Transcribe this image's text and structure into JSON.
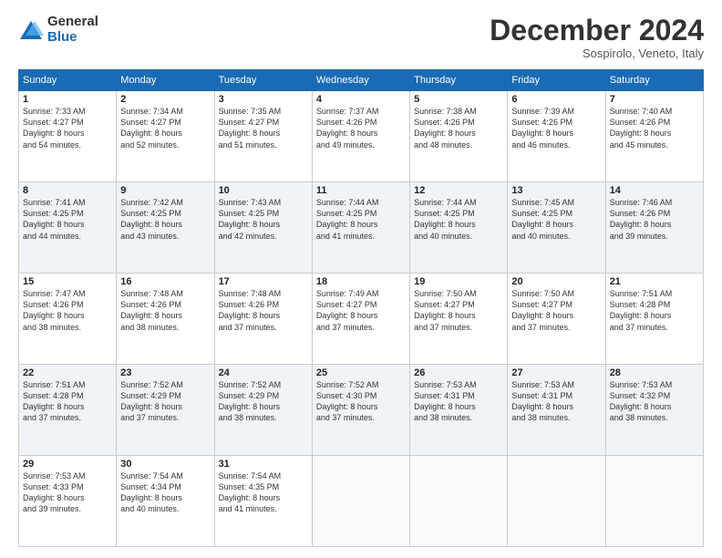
{
  "logo": {
    "general": "General",
    "blue": "Blue"
  },
  "title": "December 2024",
  "location": "Sospirolo, Veneto, Italy",
  "headers": [
    "Sunday",
    "Monday",
    "Tuesday",
    "Wednesday",
    "Thursday",
    "Friday",
    "Saturday"
  ],
  "weeks": [
    [
      {
        "day": "1",
        "info": "Sunrise: 7:33 AM\nSunset: 4:27 PM\nDaylight: 8 hours\nand 54 minutes."
      },
      {
        "day": "2",
        "info": "Sunrise: 7:34 AM\nSunset: 4:27 PM\nDaylight: 8 hours\nand 52 minutes."
      },
      {
        "day": "3",
        "info": "Sunrise: 7:35 AM\nSunset: 4:27 PM\nDaylight: 8 hours\nand 51 minutes."
      },
      {
        "day": "4",
        "info": "Sunrise: 7:37 AM\nSunset: 4:26 PM\nDaylight: 8 hours\nand 49 minutes."
      },
      {
        "day": "5",
        "info": "Sunrise: 7:38 AM\nSunset: 4:26 PM\nDaylight: 8 hours\nand 48 minutes."
      },
      {
        "day": "6",
        "info": "Sunrise: 7:39 AM\nSunset: 4:26 PM\nDaylight: 8 hours\nand 46 minutes."
      },
      {
        "day": "7",
        "info": "Sunrise: 7:40 AM\nSunset: 4:26 PM\nDaylight: 8 hours\nand 45 minutes."
      }
    ],
    [
      {
        "day": "8",
        "info": "Sunrise: 7:41 AM\nSunset: 4:25 PM\nDaylight: 8 hours\nand 44 minutes."
      },
      {
        "day": "9",
        "info": "Sunrise: 7:42 AM\nSunset: 4:25 PM\nDaylight: 8 hours\nand 43 minutes."
      },
      {
        "day": "10",
        "info": "Sunrise: 7:43 AM\nSunset: 4:25 PM\nDaylight: 8 hours\nand 42 minutes."
      },
      {
        "day": "11",
        "info": "Sunrise: 7:44 AM\nSunset: 4:25 PM\nDaylight: 8 hours\nand 41 minutes."
      },
      {
        "day": "12",
        "info": "Sunrise: 7:44 AM\nSunset: 4:25 PM\nDaylight: 8 hours\nand 40 minutes."
      },
      {
        "day": "13",
        "info": "Sunrise: 7:45 AM\nSunset: 4:25 PM\nDaylight: 8 hours\nand 40 minutes."
      },
      {
        "day": "14",
        "info": "Sunrise: 7:46 AM\nSunset: 4:26 PM\nDaylight: 8 hours\nand 39 minutes."
      }
    ],
    [
      {
        "day": "15",
        "info": "Sunrise: 7:47 AM\nSunset: 4:26 PM\nDaylight: 8 hours\nand 38 minutes."
      },
      {
        "day": "16",
        "info": "Sunrise: 7:48 AM\nSunset: 4:26 PM\nDaylight: 8 hours\nand 38 minutes."
      },
      {
        "day": "17",
        "info": "Sunrise: 7:48 AM\nSunset: 4:26 PM\nDaylight: 8 hours\nand 37 minutes."
      },
      {
        "day": "18",
        "info": "Sunrise: 7:49 AM\nSunset: 4:27 PM\nDaylight: 8 hours\nand 37 minutes."
      },
      {
        "day": "19",
        "info": "Sunrise: 7:50 AM\nSunset: 4:27 PM\nDaylight: 8 hours\nand 37 minutes."
      },
      {
        "day": "20",
        "info": "Sunrise: 7:50 AM\nSunset: 4:27 PM\nDaylight: 8 hours\nand 37 minutes."
      },
      {
        "day": "21",
        "info": "Sunrise: 7:51 AM\nSunset: 4:28 PM\nDaylight: 8 hours\nand 37 minutes."
      }
    ],
    [
      {
        "day": "22",
        "info": "Sunrise: 7:51 AM\nSunset: 4:28 PM\nDaylight: 8 hours\nand 37 minutes."
      },
      {
        "day": "23",
        "info": "Sunrise: 7:52 AM\nSunset: 4:29 PM\nDaylight: 8 hours\nand 37 minutes."
      },
      {
        "day": "24",
        "info": "Sunrise: 7:52 AM\nSunset: 4:29 PM\nDaylight: 8 hours\nand 38 minutes."
      },
      {
        "day": "25",
        "info": "Sunrise: 7:52 AM\nSunset: 4:30 PM\nDaylight: 8 hours\nand 37 minutes."
      },
      {
        "day": "26",
        "info": "Sunrise: 7:53 AM\nSunset: 4:31 PM\nDaylight: 8 hours\nand 38 minutes."
      },
      {
        "day": "27",
        "info": "Sunrise: 7:53 AM\nSunset: 4:31 PM\nDaylight: 8 hours\nand 38 minutes."
      },
      {
        "day": "28",
        "info": "Sunrise: 7:53 AM\nSunset: 4:32 PM\nDaylight: 8 hours\nand 38 minutes."
      }
    ],
    [
      {
        "day": "29",
        "info": "Sunrise: 7:53 AM\nSunset: 4:33 PM\nDaylight: 8 hours\nand 39 minutes."
      },
      {
        "day": "30",
        "info": "Sunrise: 7:54 AM\nSunset: 4:34 PM\nDaylight: 8 hours\nand 40 minutes."
      },
      {
        "day": "31",
        "info": "Sunrise: 7:54 AM\nSunset: 4:35 PM\nDaylight: 8 hours\nand 41 minutes."
      },
      {
        "day": "",
        "info": ""
      },
      {
        "day": "",
        "info": ""
      },
      {
        "day": "",
        "info": ""
      },
      {
        "day": "",
        "info": ""
      }
    ]
  ]
}
